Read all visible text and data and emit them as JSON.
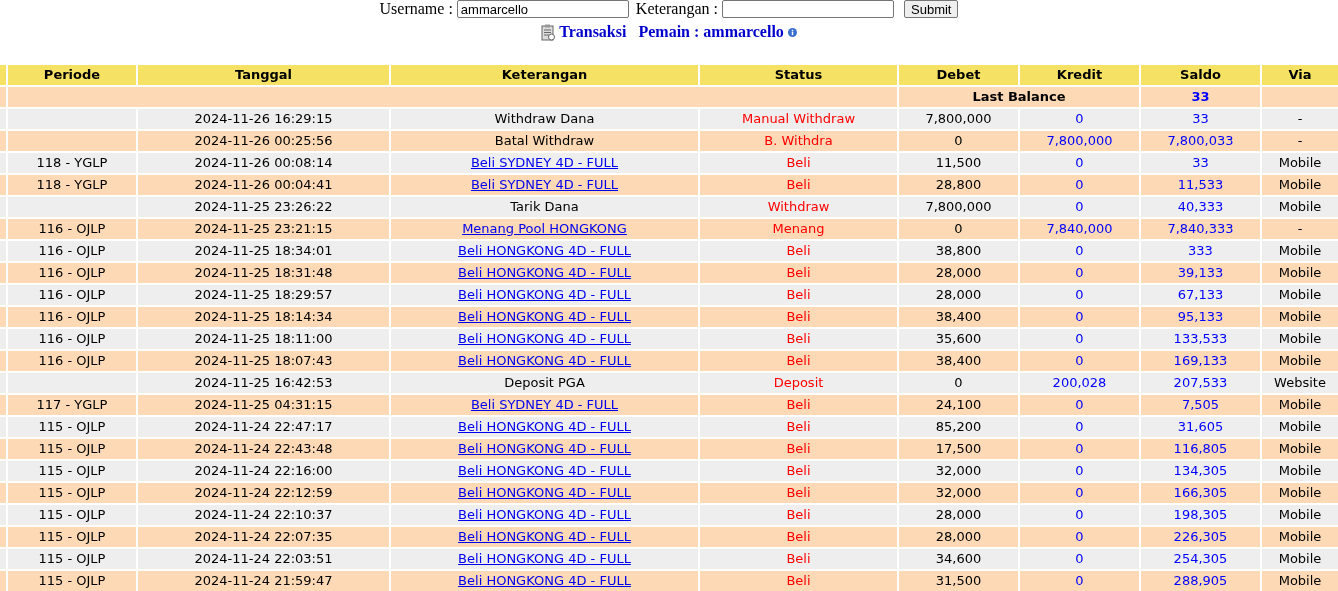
{
  "form": {
    "username_label": "Username :",
    "username_value": "ammarcello",
    "keterangan_label": "Keterangan :",
    "submit": "Submit"
  },
  "nav": {
    "transaksi": "Transaksi",
    "pemain": "Pemain : ammarcello"
  },
  "table": {
    "columns": [
      "Periode",
      "Tanggal",
      "Keterangan",
      "Status",
      "Debet",
      "Kredit",
      "Saldo",
      "Via"
    ],
    "last_balance": {
      "label": "Last Balance",
      "saldo": "33"
    },
    "rows": [
      {
        "tanggal": "2024-11-26 16:29:15",
        "keterangan": "Withdraw Dana",
        "kind": "text",
        "status": "Manual Withdraw",
        "debet": "7,800,000",
        "kredit": "0",
        "saldo": "33",
        "via": "-"
      },
      {
        "tanggal": "2024-11-26 00:25:56",
        "keterangan": "Batal Withdraw",
        "kind": "text",
        "status": "B. Withdra",
        "debet": "0",
        "kredit": "7,800,000",
        "saldo": "7,800,033",
        "via": "-"
      },
      {
        "periode": "118 - YGLP",
        "tanggal": "2024-11-26 00:08:14",
        "keterangan": "Beli SYDNEY 4D - FULL",
        "kind": "link",
        "status": "Beli",
        "debet": "11,500",
        "kredit": "0",
        "saldo": "33",
        "via": "Mobile"
      },
      {
        "periode": "118 - YGLP",
        "tanggal": "2024-11-26 00:04:41",
        "keterangan": "Beli SYDNEY 4D - FULL",
        "kind": "link",
        "status": "Beli",
        "debet": "28,800",
        "kredit": "0",
        "saldo": "11,533",
        "via": "Mobile"
      },
      {
        "tanggal": "2024-11-25 23:26:22",
        "keterangan": "Tarik Dana",
        "kind": "text",
        "status": "Withdraw",
        "debet": "7,800,000",
        "kredit": "0",
        "saldo": "40,333",
        "via": "Mobile"
      },
      {
        "periode": "116 - OJLP",
        "tanggal": "2024-11-25 23:21:15",
        "keterangan": "Menang Pool HONGKONG",
        "kind": "link",
        "status": "Menang",
        "debet": "0",
        "kredit": "7,840,000",
        "saldo": "7,840,333",
        "via": "-"
      },
      {
        "periode": "116 - OJLP",
        "tanggal": "2024-11-25 18:34:01",
        "keterangan": "Beli HONGKONG 4D - FULL",
        "kind": "link",
        "status": "Beli",
        "debet": "38,800",
        "kredit": "0",
        "saldo": "333",
        "via": "Mobile"
      },
      {
        "periode": "116 - OJLP",
        "tanggal": "2024-11-25 18:31:48",
        "keterangan": "Beli HONGKONG 4D - FULL",
        "kind": "link",
        "status": "Beli",
        "debet": "28,000",
        "kredit": "0",
        "saldo": "39,133",
        "via": "Mobile"
      },
      {
        "periode": "116 - OJLP",
        "tanggal": "2024-11-25 18:29:57",
        "keterangan": "Beli HONGKONG 4D - FULL",
        "kind": "link",
        "status": "Beli",
        "debet": "28,000",
        "kredit": "0",
        "saldo": "67,133",
        "via": "Mobile"
      },
      {
        "periode": "116 - OJLP",
        "tanggal": "2024-11-25 18:14:34",
        "keterangan": "Beli HONGKONG 4D - FULL",
        "kind": "link",
        "status": "Beli",
        "debet": "38,400",
        "kredit": "0",
        "saldo": "95,133",
        "via": "Mobile"
      },
      {
        "periode": "116 - OJLP",
        "tanggal": "2024-11-25 18:11:00",
        "keterangan": "Beli HONGKONG 4D - FULL",
        "kind": "link",
        "status": "Beli",
        "debet": "35,600",
        "kredit": "0",
        "saldo": "133,533",
        "via": "Mobile"
      },
      {
        "periode": "116 - OJLP",
        "tanggal": "2024-11-25 18:07:43",
        "keterangan": "Beli HONGKONG 4D - FULL",
        "kind": "link",
        "status": "Beli",
        "debet": "38,400",
        "kredit": "0",
        "saldo": "169,133",
        "via": "Mobile"
      },
      {
        "tanggal": "2024-11-25 16:42:53",
        "keterangan": "Deposit PGA",
        "kind": "text",
        "status": "Deposit",
        "debet": "0",
        "kredit": "200,028",
        "saldo": "207,533",
        "via": "Website"
      },
      {
        "periode": "117 - YGLP",
        "tanggal": "2024-11-25 04:31:15",
        "keterangan": "Beli SYDNEY 4D - FULL",
        "kind": "link",
        "status": "Beli",
        "debet": "24,100",
        "kredit": "0",
        "saldo": "7,505",
        "via": "Mobile"
      },
      {
        "periode": "115 - OJLP",
        "tanggal": "2024-11-24 22:47:17",
        "keterangan": "Beli HONGKONG 4D - FULL",
        "kind": "link",
        "status": "Beli",
        "debet": "85,200",
        "kredit": "0",
        "saldo": "31,605",
        "via": "Mobile"
      },
      {
        "periode": "115 - OJLP",
        "tanggal": "2024-11-24 22:43:48",
        "keterangan": "Beli HONGKONG 4D - FULL",
        "kind": "link",
        "status": "Beli",
        "debet": "17,500",
        "kredit": "0",
        "saldo": "116,805",
        "via": "Mobile"
      },
      {
        "periode": "115 - OJLP",
        "tanggal": "2024-11-24 22:16:00",
        "keterangan": "Beli HONGKONG 4D - FULL",
        "kind": "link",
        "status": "Beli",
        "debet": "32,000",
        "kredit": "0",
        "saldo": "134,305",
        "via": "Mobile"
      },
      {
        "periode": "115 - OJLP",
        "tanggal": "2024-11-24 22:12:59",
        "keterangan": "Beli HONGKONG 4D - FULL",
        "kind": "link",
        "status": "Beli",
        "debet": "32,000",
        "kredit": "0",
        "saldo": "166,305",
        "via": "Mobile"
      },
      {
        "periode": "115 - OJLP",
        "tanggal": "2024-11-24 22:10:37",
        "keterangan": "Beli HONGKONG 4D - FULL",
        "kind": "link",
        "status": "Beli",
        "debet": "28,000",
        "kredit": "0",
        "saldo": "198,305",
        "via": "Mobile"
      },
      {
        "periode": "115 - OJLP",
        "tanggal": "2024-11-24 22:07:35",
        "keterangan": "Beli HONGKONG 4D - FULL",
        "kind": "link",
        "status": "Beli",
        "debet": "28,000",
        "kredit": "0",
        "saldo": "226,305",
        "via": "Mobile"
      },
      {
        "periode": "115 - OJLP",
        "tanggal": "2024-11-24 22:03:51",
        "keterangan": "Beli HONGKONG 4D - FULL",
        "kind": "link",
        "status": "Beli",
        "debet": "34,600",
        "kredit": "0",
        "saldo": "254,305",
        "via": "Mobile"
      },
      {
        "periode": "115 - OJLP",
        "tanggal": "2024-11-24 21:59:47",
        "keterangan": "Beli HONGKONG 4D - FULL",
        "kind": "link",
        "status": "Beli",
        "debet": "31,500",
        "kredit": "0",
        "saldo": "288,905",
        "via": "Mobile"
      }
    ]
  }
}
